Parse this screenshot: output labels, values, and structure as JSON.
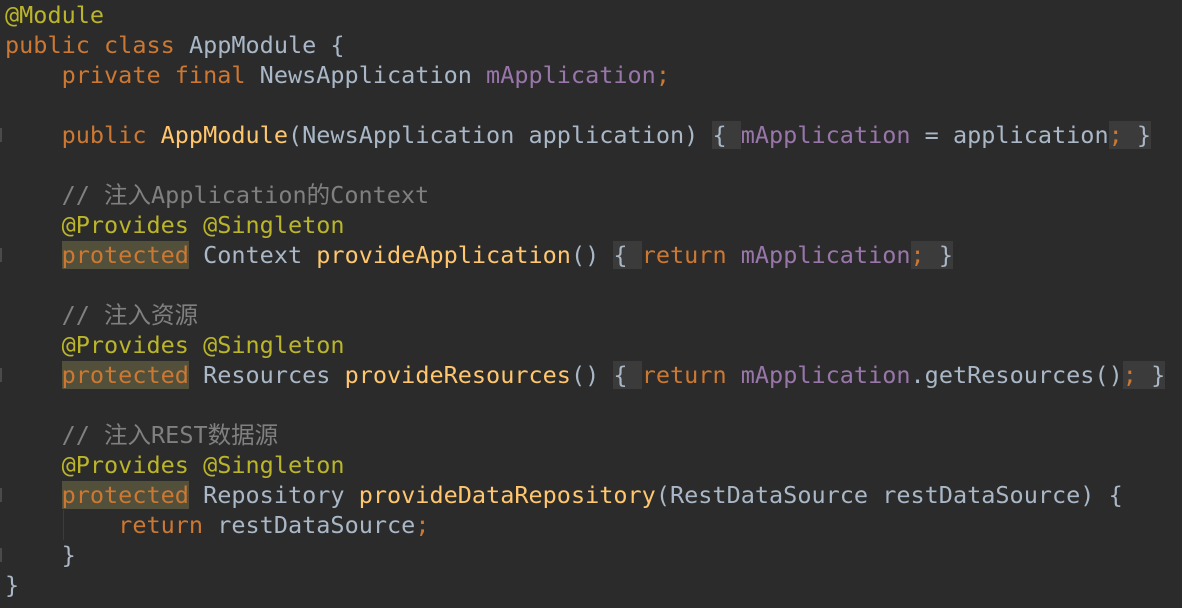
{
  "theme": {
    "background": "#2b2b2b",
    "keyword": "#cc7832",
    "annotation": "#bbb529",
    "method": "#ffc66d",
    "field": "#9876aa",
    "text": "#a9b7c6",
    "comment": "#808080",
    "warning_highlight": "#52503a",
    "fold_highlight": "#3b3b3b"
  },
  "code": {
    "lines": [
      [
        {
          "text": "@Module",
          "kind": "annotation"
        }
      ],
      [
        {
          "text": "public class ",
          "kind": "keyword"
        },
        {
          "text": "AppModule {",
          "kind": "plain"
        }
      ],
      [
        {
          "text": "    private final ",
          "kind": "keyword"
        },
        {
          "text": "NewsApplication ",
          "kind": "plain"
        },
        {
          "text": "mApplication",
          "kind": "field"
        },
        {
          "text": ";",
          "kind": "keyword"
        }
      ],
      [],
      [
        {
          "text": "    public ",
          "kind": "keyword"
        },
        {
          "text": "AppModule",
          "kind": "method"
        },
        {
          "text": "(NewsApplication application) ",
          "kind": "plain"
        },
        {
          "text": "{ ",
          "kind": "plain",
          "mark": "fold"
        },
        {
          "text": "mApplication",
          "kind": "field"
        },
        {
          "text": " = application",
          "kind": "plain"
        },
        {
          "text": ";",
          "kind": "keyword",
          "mark": "fold"
        },
        {
          "text": " }",
          "kind": "plain",
          "mark": "fold"
        }
      ],
      [],
      [
        {
          "text": "    // 注入Application的Context",
          "kind": "comment"
        }
      ],
      [
        {
          "text": "    @Provides @Singleton",
          "kind": "annotation"
        }
      ],
      [
        {
          "text": "    ",
          "kind": "plain"
        },
        {
          "text": "protected",
          "kind": "keyword",
          "mark": "warn"
        },
        {
          "text": " Context ",
          "kind": "plain"
        },
        {
          "text": "provideApplication",
          "kind": "method"
        },
        {
          "text": "() ",
          "kind": "plain"
        },
        {
          "text": "{ ",
          "kind": "plain",
          "mark": "fold"
        },
        {
          "text": "return ",
          "kind": "keyword"
        },
        {
          "text": "mApplication",
          "kind": "field"
        },
        {
          "text": ";",
          "kind": "keyword",
          "mark": "fold"
        },
        {
          "text": " }",
          "kind": "plain",
          "mark": "fold"
        }
      ],
      [],
      [
        {
          "text": "    // 注入资源",
          "kind": "comment"
        }
      ],
      [
        {
          "text": "    @Provides @Singleton",
          "kind": "annotation"
        }
      ],
      [
        {
          "text": "    ",
          "kind": "plain"
        },
        {
          "text": "protected",
          "kind": "keyword",
          "mark": "warn"
        },
        {
          "text": " Resources ",
          "kind": "plain"
        },
        {
          "text": "provideResources",
          "kind": "method"
        },
        {
          "text": "() ",
          "kind": "plain"
        },
        {
          "text": "{ ",
          "kind": "plain",
          "mark": "fold"
        },
        {
          "text": "return ",
          "kind": "keyword"
        },
        {
          "text": "mApplication",
          "kind": "field"
        },
        {
          "text": ".getResources()",
          "kind": "plain"
        },
        {
          "text": ";",
          "kind": "keyword",
          "mark": "fold"
        },
        {
          "text": " }",
          "kind": "plain",
          "mark": "fold"
        }
      ],
      [],
      [
        {
          "text": "    // 注入REST数据源",
          "kind": "comment"
        }
      ],
      [
        {
          "text": "    @Provides @Singleton",
          "kind": "annotation"
        }
      ],
      [
        {
          "text": "    ",
          "kind": "plain"
        },
        {
          "text": "protected",
          "kind": "keyword",
          "mark": "warn"
        },
        {
          "text": " Repository ",
          "kind": "plain"
        },
        {
          "text": "provideDataRepository",
          "kind": "method"
        },
        {
          "text": "(RestDataSource restDataSource) {",
          "kind": "plain"
        }
      ],
      [
        {
          "text": "        return ",
          "kind": "keyword"
        },
        {
          "text": "restDataSource",
          "kind": "plain"
        },
        {
          "text": ";",
          "kind": "keyword"
        }
      ],
      [
        {
          "text": "    }",
          "kind": "plain"
        }
      ],
      [
        {
          "text": "}",
          "kind": "plain"
        }
      ]
    ]
  }
}
